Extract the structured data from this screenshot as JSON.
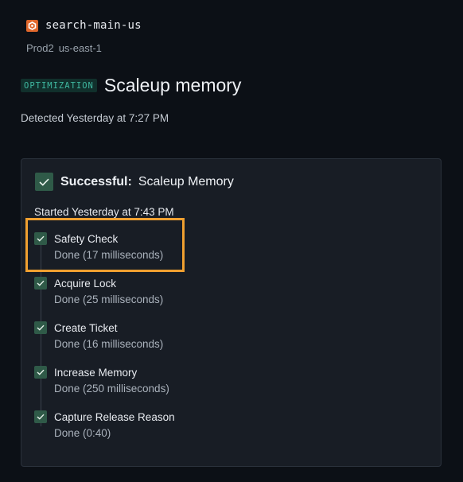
{
  "service": {
    "icon": "service-hexagon-icon",
    "name": "search-main-us",
    "env": "Prod2",
    "region": "us-east-1"
  },
  "header": {
    "badge": "OPTIMIZATION",
    "title": "Scaleup memory",
    "detected": "Detected Yesterday at 7:27 PM"
  },
  "card": {
    "status_label": "Successful:",
    "status_value": "Scaleup Memory",
    "started": "Started Yesterday at 7:43 PM",
    "steps": [
      {
        "name": "Safety Check",
        "status": "Done (17 milliseconds)"
      },
      {
        "name": "Acquire Lock",
        "status": "Done (25 milliseconds)"
      },
      {
        "name": "Create Ticket",
        "status": "Done (16 milliseconds)"
      },
      {
        "name": "Increase Memory",
        "status": "Done (250 milliseconds)"
      },
      {
        "name": "Capture Release Reason",
        "status": "Done (0:40)"
      }
    ]
  },
  "colors": {
    "accent": "#3fb8a0",
    "check_bg": "#2f5a48",
    "highlight": "#f0a030",
    "service_icon": "#e0672b"
  }
}
